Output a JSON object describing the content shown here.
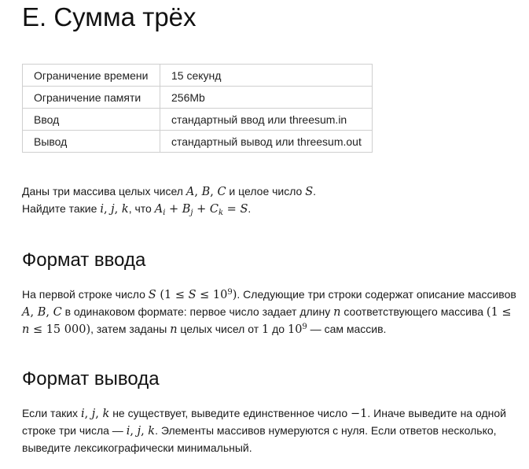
{
  "title": "E. Сумма трёх",
  "limits": [
    {
      "label": "Ограничение времени",
      "value": "15 секунд"
    },
    {
      "label": "Ограничение памяти",
      "value": "256Mb"
    },
    {
      "label": "Ввод",
      "value": "стандартный ввод или threesum.in"
    },
    {
      "label": "Вывод",
      "value": "стандартный вывод или threesum.out"
    }
  ],
  "statement": {
    "line1_a": "Даны три массива целых чисел ",
    "line1_b": " и целое число ",
    "line1_c": ".",
    "line2_a": "Найдите такие ",
    "line2_b": ", что ",
    "line2_c": "."
  },
  "input_section": {
    "heading": "Формат ввода",
    "t1": "На первой строке число ",
    "t2": ". Следующие три строки содержат описание массивов ",
    "t3": " в одинаковом формате: первое число задает длину ",
    "t4": " соответствующего массива ",
    "t5": ", затем заданы ",
    "t6": " целых чисел от ",
    "t7": " до ",
    "t8": " — сам массив."
  },
  "output_section": {
    "heading": "Формат вывода",
    "t1": "Если таких ",
    "t2": " не существует, выведите единственное число ",
    "t3": ". Иначе выведите на одной строке три числа — ",
    "t4": ". Элементы массивов нумеруются с нуля. Если ответов несколько, выведите лексикографически минимальный."
  }
}
